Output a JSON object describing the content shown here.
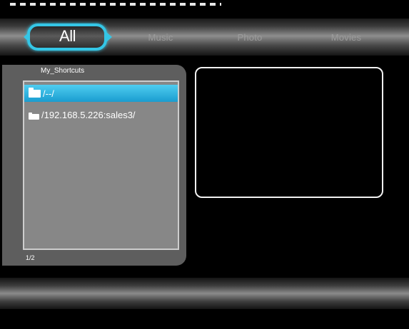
{
  "tabs": [
    {
      "label": "All",
      "selected": true
    },
    {
      "label": "Music",
      "selected": false
    },
    {
      "label": "Photo",
      "selected": false
    },
    {
      "label": "Movies",
      "selected": false
    }
  ],
  "shortcuts": {
    "title": "My_Shortcuts",
    "items": [
      {
        "icon": "folder-icon",
        "label": "/--/",
        "selected": true
      },
      {
        "icon": "folder-icon",
        "label": "/192.168.5.226:sales3/",
        "selected": false
      }
    ],
    "page_indicator": "1/2"
  },
  "colors": {
    "accent": "#34c6e6",
    "selection": "#1a9dd0",
    "panel": "#5e5e5e",
    "list_bg": "#878787",
    "background": "#000000"
  }
}
